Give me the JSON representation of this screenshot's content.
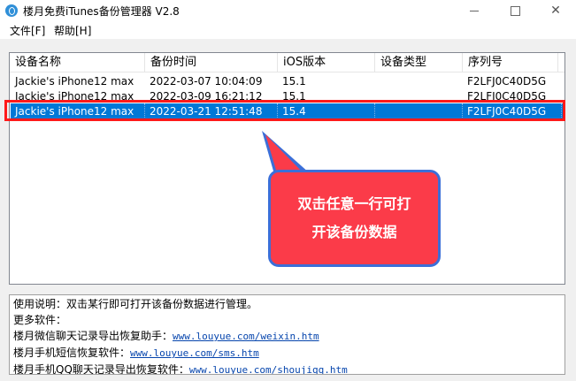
{
  "window": {
    "title": "楼月免费iTunes备份管理器 V2.8",
    "icon": "music-note-icon"
  },
  "menu": [
    {
      "label": "文件[F]"
    },
    {
      "label": "帮助[H]"
    }
  ],
  "table": {
    "columns": [
      "设备名称",
      "备份时间",
      "iOS版本",
      "设备类型",
      "序列号"
    ],
    "rows": [
      {
        "name": "Jackie's iPhone12 max",
        "time": "2022-03-07 10:04:09",
        "ios": "15.1",
        "type": "",
        "serial": "F2LFJ0C40D5G"
      },
      {
        "name": "Jackie's iPhone12 max",
        "time": "2022-03-09 16:21:12",
        "ios": "15.1",
        "type": "",
        "serial": "F2LFJ0C40D5G"
      },
      {
        "name": "Jackie's iPhone12 max",
        "time": "2022-03-21 12:51:48",
        "ios": "15.4",
        "type": "",
        "serial": "F2LFJ0C40D5G"
      }
    ],
    "selected_index": 2
  },
  "callout": {
    "line1": "双击任意一行可打",
    "line2": "开该备份数据"
  },
  "info": {
    "usage": "使用说明：双击某行即可打开该备份数据进行管理。",
    "more": "更多软件：",
    "links": [
      {
        "label": "楼月微信聊天记录导出恢复助手：",
        "url": "www.louyue.com/weixin.htm"
      },
      {
        "label": "楼月手机短信恢复软件：",
        "url": "www.louyue.com/sms.htm"
      },
      {
        "label": "楼月手机QQ聊天记录导出恢复软件：",
        "url": "www.louyue.com/shoujiqq.htm"
      }
    ]
  },
  "colors": {
    "selection": "#0078d7",
    "highlight_border": "#ff1a1a",
    "callout_fill": "#fb3b49",
    "callout_border": "#3b6fd8",
    "link": "#0645ad"
  }
}
